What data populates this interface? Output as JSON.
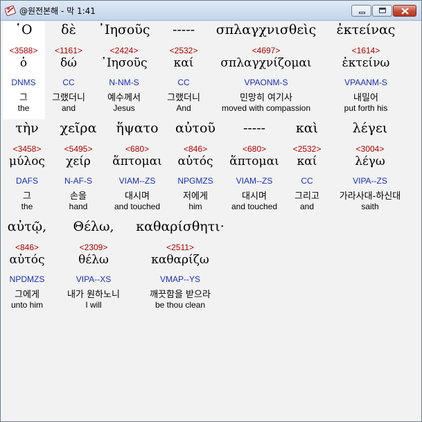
{
  "window": {
    "title": "@원전본해 - 막 1:41"
  },
  "rows": [
    [
      {
        "greek": "῾Ο",
        "strong": "<3588>",
        "lemma": "ὁ",
        "morph": "DNMS",
        "korean": "그",
        "english": "the"
      },
      {
        "greek": "δὲ",
        "strong": "<1161>",
        "lemma": "δώ",
        "morph": "CC",
        "korean": "그랬더니",
        "english": "and"
      },
      {
        "greek": "᾽Ιησοῦς",
        "strong": "<2424>",
        "lemma": "᾽Ιησοῦς",
        "morph": "N-NM-S",
        "korean": "예수께서",
        "english": "Jesus"
      },
      {
        "greek": "-----",
        "strong": "<2532>",
        "lemma": "καί",
        "morph": "CC",
        "korean": "그랬더니",
        "english": "And"
      },
      {
        "greek": "σπλαγχνισθεὶς",
        "strong": "<4697>",
        "lemma": "σπλαγχνίζομαι",
        "morph": "VPAONM-S",
        "korean": "민망히 여기사",
        "english": "moved with compassion"
      },
      {
        "greek": "ἐκτείνας",
        "strong": "<1614>",
        "lemma": "ἐκτείνω",
        "morph": "VPAANM-S",
        "korean": "내밀어",
        "english": "put forth his"
      }
    ],
    [
      {
        "greek": "τὴν",
        "strong": "<3458>",
        "lemma": "μύλος",
        "morph": "DAFS",
        "korean": "그",
        "english": "the"
      },
      {
        "greek": "χεῖρα",
        "strong": "<5495>",
        "lemma": "χείρ",
        "morph": "N-AF-S",
        "korean": "손을",
        "english": "hand"
      },
      {
        "greek": "ἥψατο",
        "strong": "<680>",
        "lemma": "ἅπτομαι",
        "morph": "VIAM--ZS",
        "korean": "대시며",
        "english": "and touched"
      },
      {
        "greek": "αὐτοῦ",
        "strong": "<846>",
        "lemma": "αὐτός",
        "morph": "NPGMZS",
        "korean": "저에게",
        "english": "him"
      },
      {
        "greek": "-----",
        "strong": "<680>",
        "lemma": "ἅπτομαι",
        "morph": "VIAM--ZS",
        "korean": "대시며",
        "english": "and touched"
      },
      {
        "greek": "καὶ",
        "strong": "<2532>",
        "lemma": "καί",
        "morph": "CC",
        "korean": "그리고",
        "english": "and"
      },
      {
        "greek": "λέγει",
        "strong": "<3004>",
        "lemma": "λέγω",
        "morph": "VIPA--ZS",
        "korean": "가라사대-하신대",
        "english": "saith"
      }
    ],
    [
      {
        "greek": "αὐτῷ,",
        "strong": "<846>",
        "lemma": "αὐτός",
        "morph": "NPDMZS",
        "korean": "그에게",
        "english": "unto him"
      },
      {
        "greek": "Θέλω,",
        "strong": "<2309>",
        "lemma": "θέλω",
        "morph": "VIPA--XS",
        "korean": "내가 원하노니",
        "english": "I will"
      },
      {
        "greek": "καθαρίσθητι·",
        "strong": "<2511>",
        "lemma": "καθαρίζω",
        "morph": "VMAP--YS",
        "korean": "깨끗함을 받으라",
        "english": "be thou clean"
      }
    ]
  ]
}
